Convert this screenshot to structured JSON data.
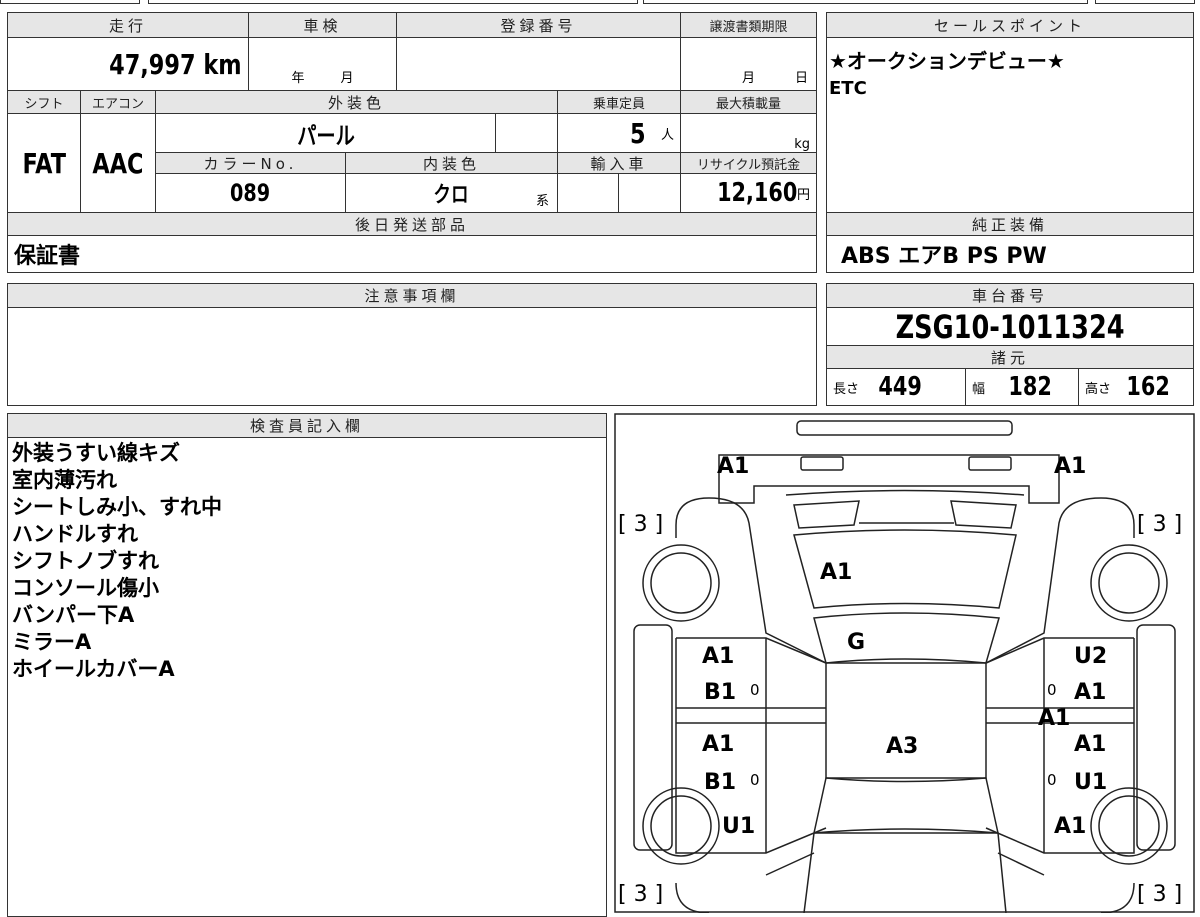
{
  "headers": {
    "mileage": "走行",
    "inspection": "車検",
    "registration": "登録番号",
    "transfer_deadline": "譲渡書類期限",
    "shift": "シフト",
    "aircon": "エアコン",
    "exterior_color": "外装色",
    "capacity": "乗車定員",
    "max_load": "最大積載量",
    "color_no": "カラーNo.",
    "interior_color": "内装色",
    "import": "輸入車",
    "recycle": "リサイクル預託金",
    "later_parts": "後日発送部品",
    "sales_point": "セールスポイント",
    "equipment": "純正装備",
    "notes": "注意事項欄",
    "chassis": "車台番号",
    "specs": "諸元",
    "inspector": "検査員記入欄"
  },
  "values": {
    "mileage": "47,997 km",
    "insp_year": "年",
    "insp_month": "月",
    "deadline_month": "月",
    "deadline_day": "日",
    "shift": "FAT",
    "aircon": "AAC",
    "exterior_color": "パール",
    "capacity": "5",
    "capacity_unit": "人",
    "load_unit": "kg",
    "color_no": "089",
    "interior_color": "クロ",
    "interior_suffix": "系",
    "recycle": "12,160",
    "recycle_unit": "円",
    "later_parts": "保証書",
    "sales_points": [
      "★オークションデビュー★",
      "ETC"
    ],
    "equipment": "ABS エアB PS PW",
    "chassis": "ZSG10-1011324",
    "length_label": "長さ",
    "length": "449",
    "width_label": "幅",
    "width": "182",
    "height_label": "高さ",
    "height": "162"
  },
  "inspector_notes": [
    "外装うすい線キズ",
    "室内薄汚れ",
    "シートしみ小、すれ中",
    "ハンドルすれ",
    "シフトノブすれ",
    "コンソール傷小",
    "バンパー下A",
    "ミラーA",
    "ホイールカバーA"
  ],
  "diagram": {
    "tl": "A1",
    "tr": "A1",
    "bracket_tl": "[ 3 ]",
    "bracket_tr": "[ 3 ]",
    "bracket_bl": "[ 3 ]",
    "bracket_br": "[ 3 ]",
    "hood": "A1",
    "cowl": "G",
    "roof": "A3",
    "lf_door": "A1",
    "lf_lower": "B1",
    "lr_door": "A1",
    "lr_lower": "B1",
    "lr_qtr": "U1",
    "rf_door": "U2",
    "rf_lower": "A1",
    "r_pillar": "A1",
    "rr_door": "A1",
    "rr_lower": "U1",
    "rr_qtr": "A1",
    "z1": "0",
    "z2": "0",
    "z3": "0",
    "z4": "0"
  }
}
